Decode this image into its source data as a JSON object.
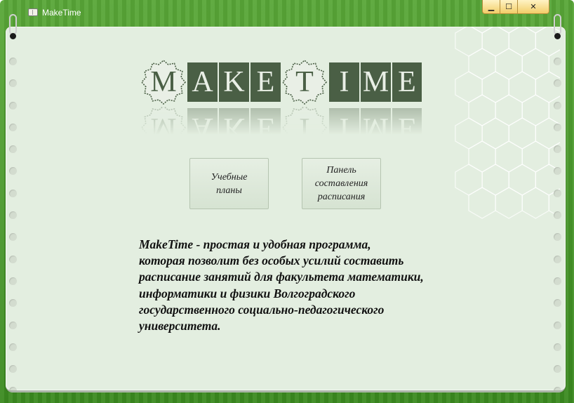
{
  "window": {
    "title": "MakeTime",
    "controls": {
      "minimize": "▁",
      "maximize": "☐",
      "close": "✕"
    }
  },
  "logo": {
    "letters": [
      "M",
      "A",
      "K",
      "E",
      "T",
      "I",
      "M",
      "E"
    ],
    "gear_letters": [
      "M",
      "T"
    ]
  },
  "buttons": {
    "plans": "Учебные\nпланы",
    "schedule_panel": "Панель\nсоставления\nрасписания"
  },
  "description": "MakeTime - простая и удобная программа,\nкоторая позволит без особых усилий составить\nрасписание занятий для факультета математики,\nинформатики и физики Волгоградского\nгосударственного социально-педагогического\nуниверситета.",
  "colors": {
    "frame": "#4c9a2e",
    "paper": "#e3eee0",
    "tile": "#4a5f45",
    "control_gold": "#f2cd68"
  },
  "icons": [
    "notebook-icon",
    "gear-icon",
    "hexagon-pattern"
  ]
}
